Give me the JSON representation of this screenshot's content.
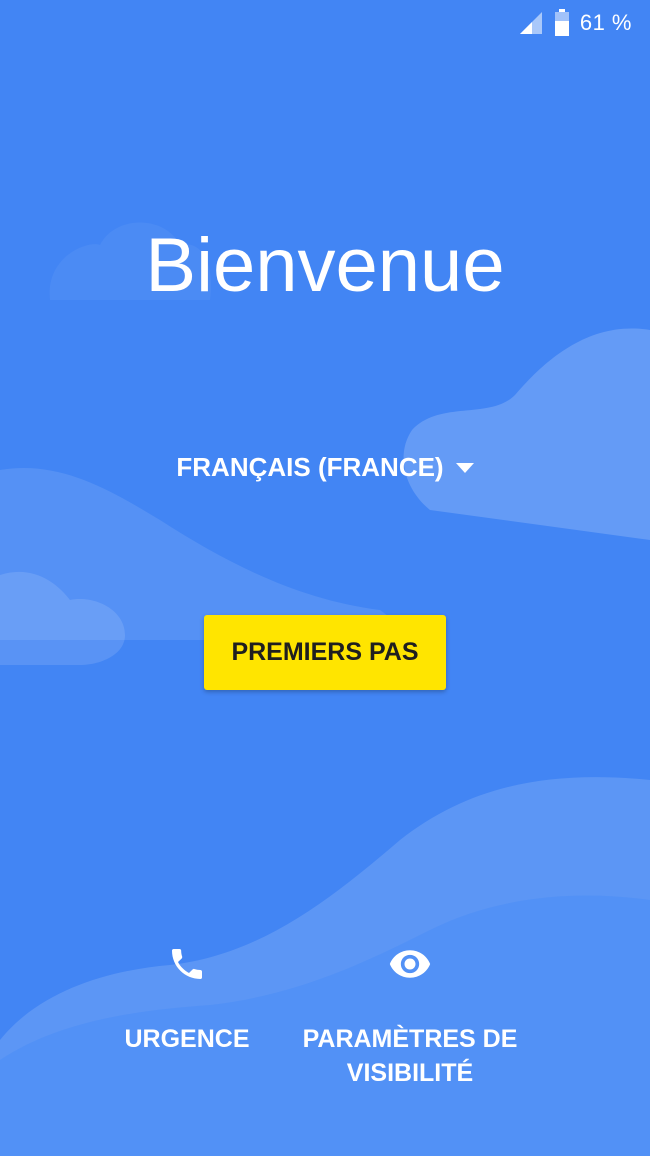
{
  "status_bar": {
    "icons": [
      "signal-icon",
      "battery-icon"
    ],
    "battery_percent": "61 %"
  },
  "welcome": {
    "title": "Bienvenue"
  },
  "language": {
    "selected": "FRANÇAIS (FRANCE)",
    "icon": "dropdown-arrow-icon"
  },
  "start_button": {
    "label": "PREMIERS PAS"
  },
  "bottom_actions": {
    "emergency": {
      "label": "URGENCE",
      "icon": "phone-icon"
    },
    "accessibility": {
      "label_line1": "PARAMÈTRES DE",
      "label_line2": "VISIBILITÉ",
      "icon": "eye-icon"
    }
  },
  "colors": {
    "background": "#4285f4",
    "accent_button": "#ffe500",
    "text": "#ffffff"
  }
}
